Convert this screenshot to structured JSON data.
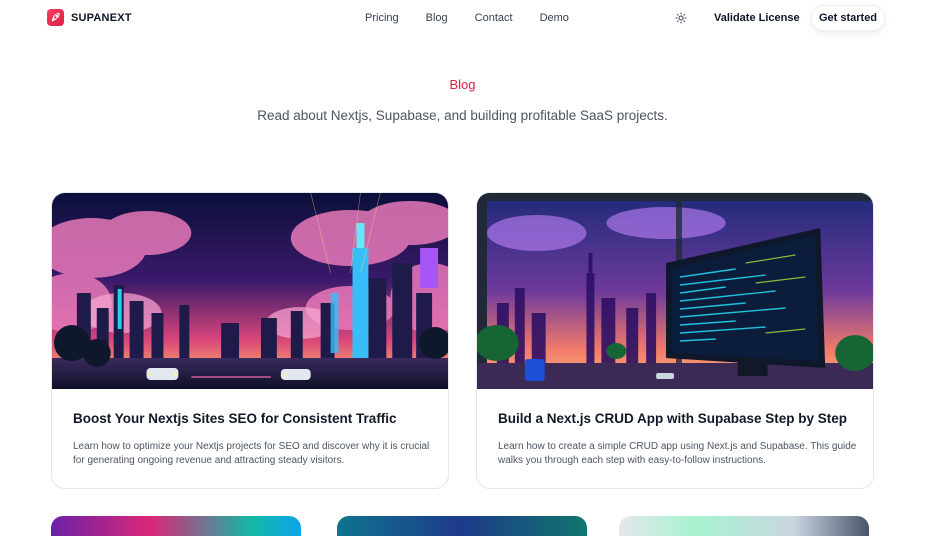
{
  "brand": {
    "name": "SUPANEXT",
    "icon": "rocket-icon",
    "color": "#e11d48"
  },
  "nav": {
    "links": [
      {
        "label": "Pricing"
      },
      {
        "label": "Blog"
      },
      {
        "label": "Contact"
      },
      {
        "label": "Demo"
      }
    ],
    "theme_icon": "sun-icon",
    "validate_label": "Validate License",
    "cta_label": "Get started"
  },
  "hero": {
    "kicker": "Blog",
    "subtitle": "Read about Nextjs, Supabase, and building profitable SaaS projects."
  },
  "posts": [
    {
      "title": "Boost Your Nextjs Sites SEO for Consistent Traffic",
      "description": "Learn how to optimize your Nextjs projects for SEO and discover why it is crucial for generating ongoing revenue and attracting steady visitors.",
      "image": "neon-city-illustration"
    },
    {
      "title": "Build a Next.js CRUD App with Supabase Step by Step",
      "description": "Learn how to create a simple CRUD app using Next.js and Supabase. This guide walks you through each step with easy-to-follow instructions.",
      "image": "code-monitor-illustration"
    }
  ],
  "colors": {
    "accent": "#e11d48",
    "text": "#111827",
    "muted": "#4b5563"
  }
}
